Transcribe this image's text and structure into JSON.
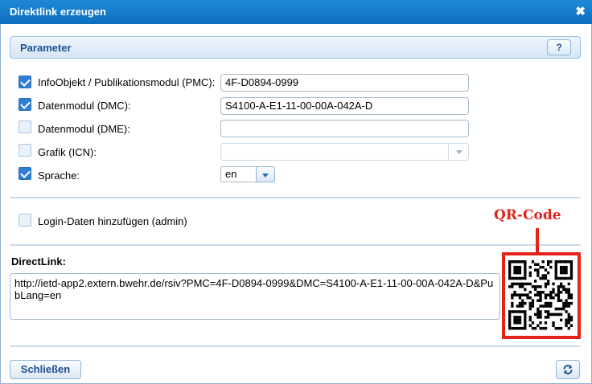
{
  "window": {
    "title": "Direktlink erzeugen"
  },
  "parameter": {
    "header": "Parameter",
    "help_label": "?",
    "rows": [
      {
        "label": "InfoObjekt / Publikationsmodul (PMC):",
        "checked": true,
        "value": "4F-D0894-0999"
      },
      {
        "label": "Datenmodul (DMC):",
        "checked": true,
        "value": "S4100-A-E1-11-00-00A-042A-D"
      },
      {
        "label": "Datenmodul (DME):",
        "checked": false,
        "value": ""
      },
      {
        "label": "Grafik (ICN):",
        "checked": false,
        "value": ""
      },
      {
        "label": "Sprache:",
        "checked": true,
        "value": "en"
      }
    ]
  },
  "login": {
    "label": "Login-Daten hinzufügen (admin)",
    "checked": false
  },
  "directlink": {
    "label": "DirectLink:",
    "url": "http://ietd-app2.extern.bwehr.de/rsiv?PMC=4F-D0894-0999&DMC=S4100-A-E1-11-00-00A-042A-D&PubLang=en"
  },
  "qr": {
    "annotation": "QR-Code"
  },
  "footer": {
    "close_label": "Schließen"
  },
  "colors": {
    "accent": "#1e88d6",
    "annotation": "#e2231a",
    "label_blue": "#1e4e8c"
  },
  "icons": {
    "close": "close-icon",
    "help": "help-icon",
    "refresh": "refresh-icon",
    "dropdown": "chevron-down-icon"
  }
}
